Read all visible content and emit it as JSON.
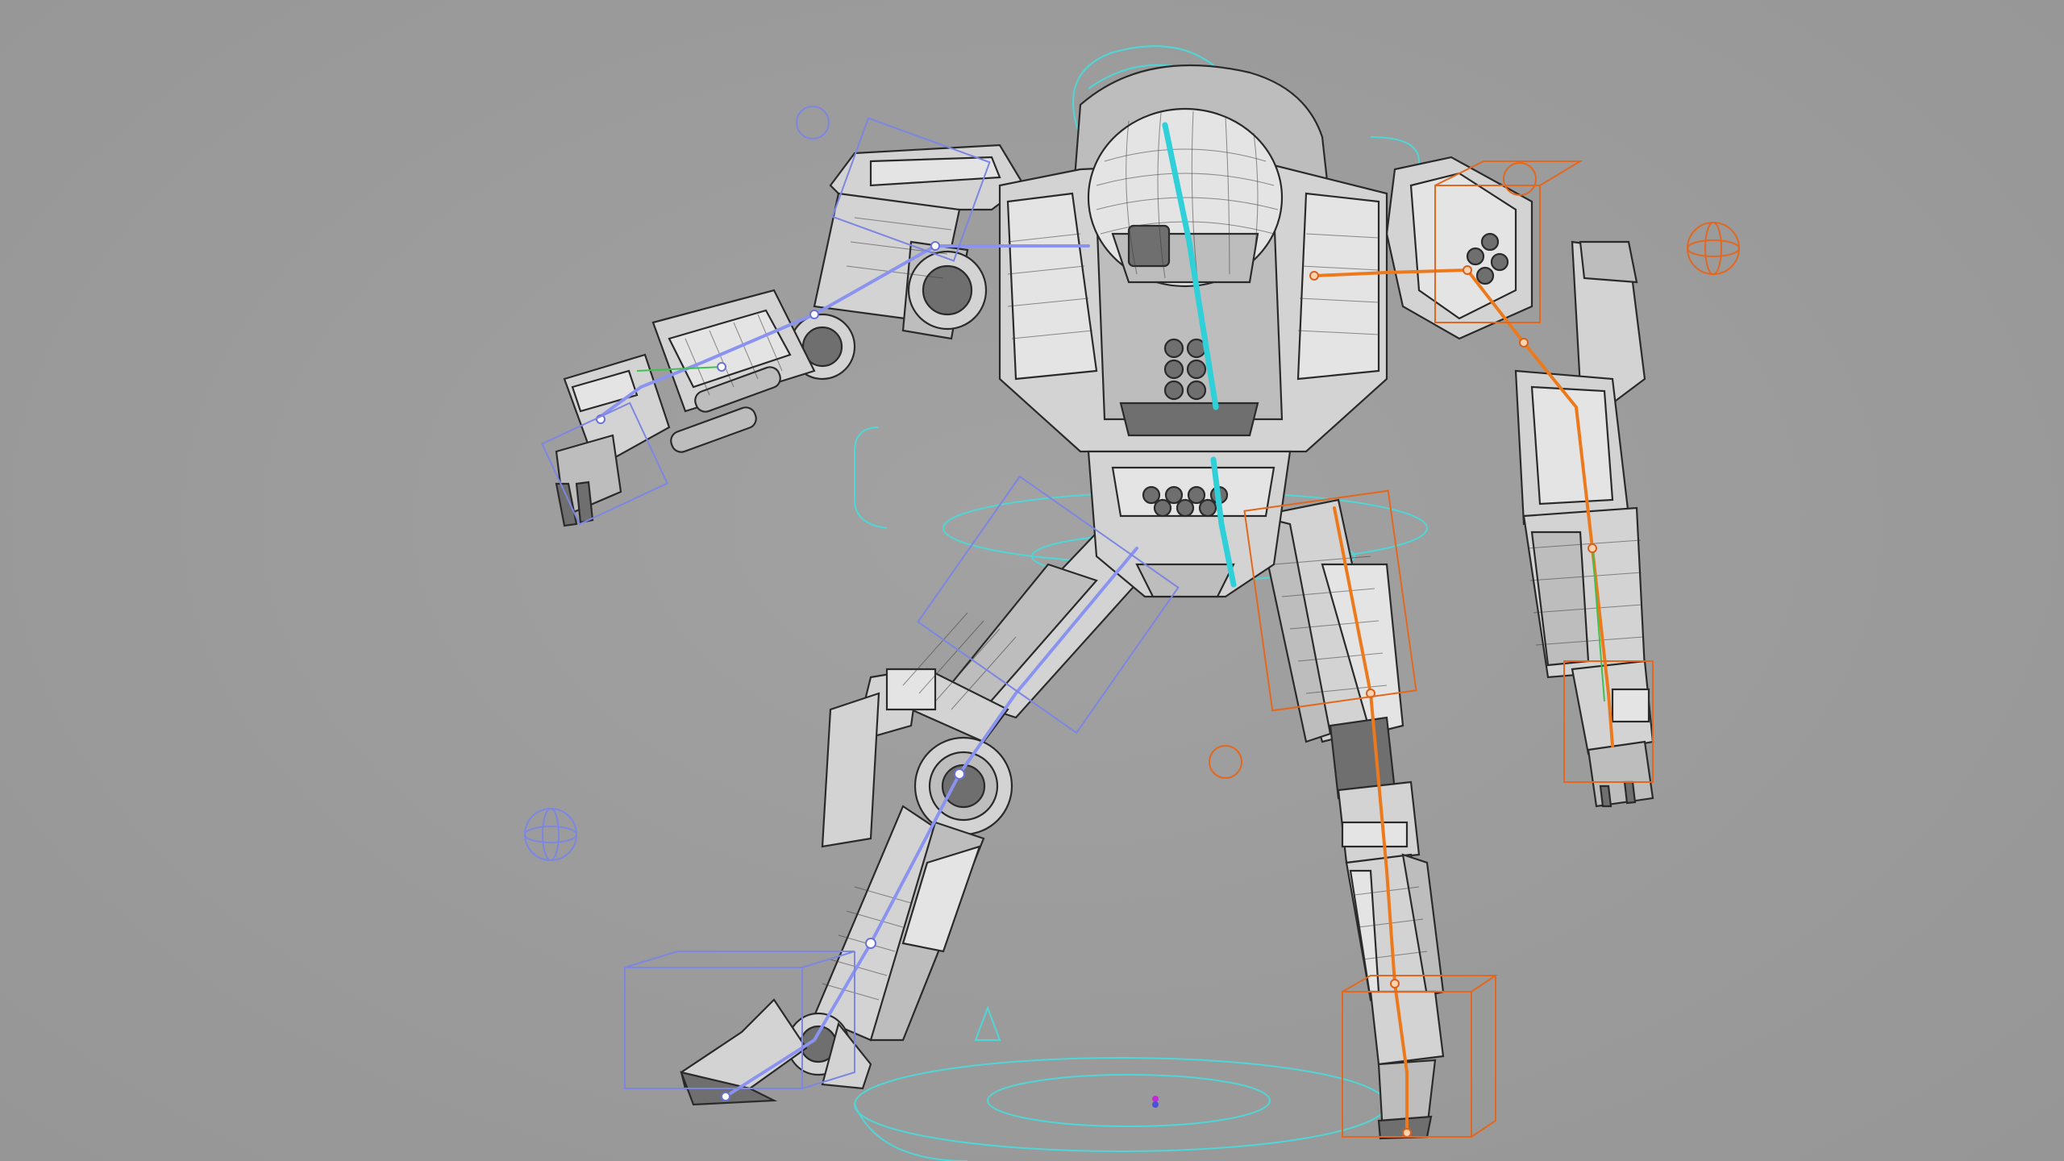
{
  "viewport": {
    "view": "3d-perspective",
    "shading": "wireframe-on-shaded",
    "subject": "robot-rig",
    "background_color": "#9a9a9a"
  },
  "colors": {
    "mesh_fill": "#d3d3d3",
    "mesh_wire": "#2a2a2a",
    "rig_left_side": "#7d86e0",
    "rig_center": "#2fd0d8",
    "rig_right_side": "#ec7a1c",
    "rig_ik_handle": "#3fc14f"
  },
  "icons": {
    "world_origin": "origin-marker-icon",
    "pole_vector_controls": "sphere-control-icon"
  }
}
